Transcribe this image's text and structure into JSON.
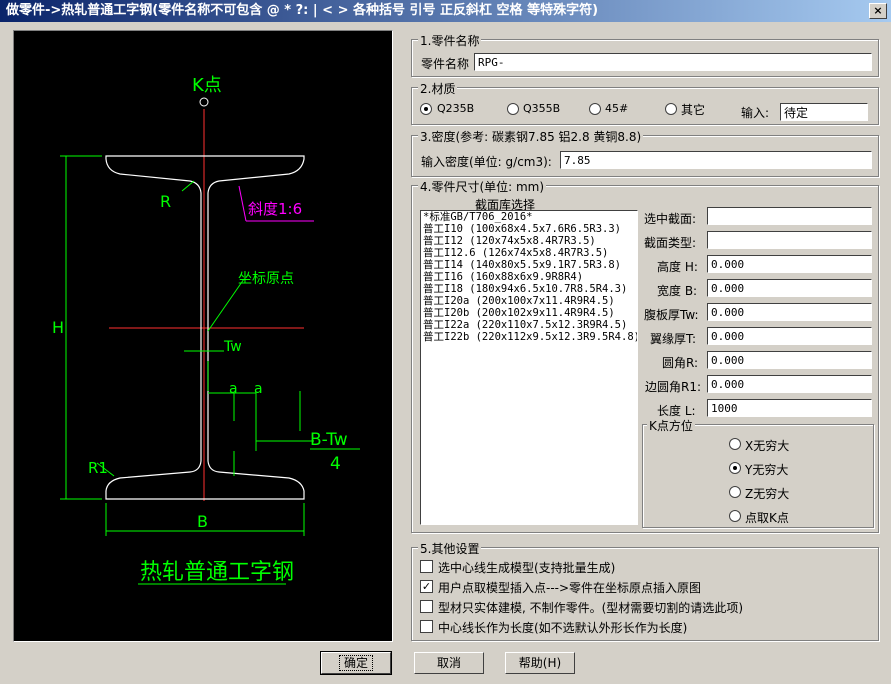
{
  "window": {
    "title": "做零件->热轧普通工字钢(零件名称不可包含 @ * ?: | < > 各种括号 引号 正反斜杠 空格 等特殊字符)",
    "close": "×"
  },
  "drawing": {
    "k_point": "K点",
    "slope": "斜度1:6",
    "origin": "坐标原点",
    "r": "R",
    "r1": "R1",
    "tw": "Tw",
    "a": "a",
    "h": "H",
    "b": "B",
    "b_tw_num": "B-Tw",
    "b_tw_den": "4",
    "caption": "热轧普通工字钢"
  },
  "part_name": {
    "group": "1.零件名称",
    "label": "零件名称",
    "value": "RPG-"
  },
  "material": {
    "group": "2.材质",
    "options": [
      "Q235B",
      "Q355B",
      "45#",
      "其它"
    ],
    "selected": "Q235B",
    "input_label": "输入:",
    "input_value": "待定"
  },
  "density": {
    "group": "3.密度(参考: 碳素钢7.85  铝2.8 黄铜8.8)",
    "label": "输入密度(单位: g/cm3):",
    "value": "7.85"
  },
  "size": {
    "group": "4.零件尺寸(单位: mm)",
    "lib_label": "截面库选择",
    "items": [
      "*标准GB/T706_2016*",
      "普工I10 (100x68x4.5x7.6R6.5R3.3)",
      "普工I12 (120x74x5x8.4R7R3.5)",
      "普工I12.6 (126x74x5x8.4R7R3.5)",
      "普工I14 (140x80x5.5x9.1R7.5R3.8)",
      "普工I16 (160x88x6x9.9R8R4)",
      "普工I18 (180x94x6.5x10.7R8.5R4.3)",
      "普工I20a (200x100x7x11.4R9R4.5)",
      "普工I20b (200x102x9x11.4R9R4.5)",
      "普工I22a (220x110x7.5x12.3R9R4.5)",
      "普工I22b (220x112x9.5x12.3R9.5R4.8)"
    ],
    "fields": [
      {
        "label": "选中截面:",
        "value": ""
      },
      {
        "label": "截面类型:",
        "value": ""
      },
      {
        "label": "高度 H:",
        "value": "0.000"
      },
      {
        "label": "宽度 B:",
        "value": "0.000"
      },
      {
        "label": "腹板厚Tw:",
        "value": "0.000"
      },
      {
        "label": "翼缘厚T:",
        "value": "0.000"
      },
      {
        "label": "圆角R:",
        "value": "0.000"
      },
      {
        "label": "边圆角R1:",
        "value": "0.000"
      },
      {
        "label": "长度 L:",
        "value": "1000"
      }
    ],
    "k_group": "K点方位",
    "k_options": [
      "X无穷大",
      "Y无穷大",
      "Z无穷大",
      "点取K点"
    ],
    "k_selected": "Y无穷大"
  },
  "other": {
    "group": "5.其他设置",
    "checks": [
      {
        "label": "选中心线生成模型(支持批量生成)",
        "checked": false
      },
      {
        "label": "用户点取模型插入点--->零件在坐标原点插入原图",
        "checked": true
      },
      {
        "label": "型材只实体建模, 不制作零件。(型材需要切割的请选此项)",
        "checked": false
      },
      {
        "label": "中心线长作为长度(如不选默认外形长作为长度)",
        "checked": false
      }
    ]
  },
  "buttons": {
    "ok": "确定",
    "cancel": "取消",
    "help": "帮助(H)"
  }
}
